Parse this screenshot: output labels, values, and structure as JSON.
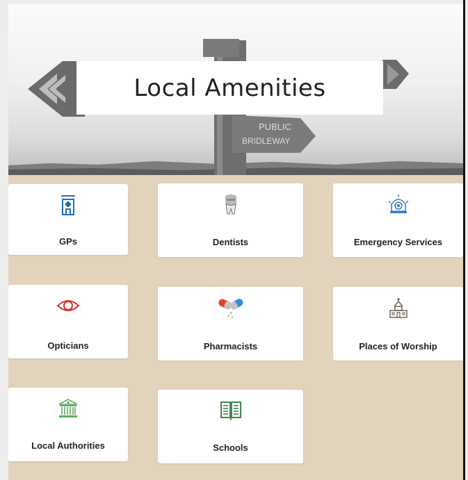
{
  "hero": {
    "title": "Local Amenities",
    "sign_text_line1": "PUBLIC",
    "sign_text_line2": "BRIDLEWAY"
  },
  "amenities": [
    {
      "label": "GPs",
      "icon": "hospital-building-icon",
      "color": "#1f6fb5"
    },
    {
      "label": "Dentists",
      "icon": "tooth-icon",
      "color": "#6e6e6e"
    },
    {
      "label": "Emergency Services",
      "icon": "emergency-siren-icon",
      "color": "#3b7fc4"
    },
    {
      "label": "Opticians",
      "icon": "eye-icon",
      "color": "#d9302a"
    },
    {
      "label": "Pharmacists",
      "icon": "pills-icon",
      "color": "#e0442e"
    },
    {
      "label": "Places of Worship",
      "icon": "church-icon",
      "color": "#6a5a4a"
    },
    {
      "label": "Local Authorities",
      "icon": "town-hall-icon",
      "color": "#5faa5f"
    },
    {
      "label": "Schools",
      "icon": "open-book-icon",
      "color": "#2f7a3a"
    }
  ],
  "colors": {
    "background": "#e2d3bd",
    "card": "#ffffff"
  }
}
